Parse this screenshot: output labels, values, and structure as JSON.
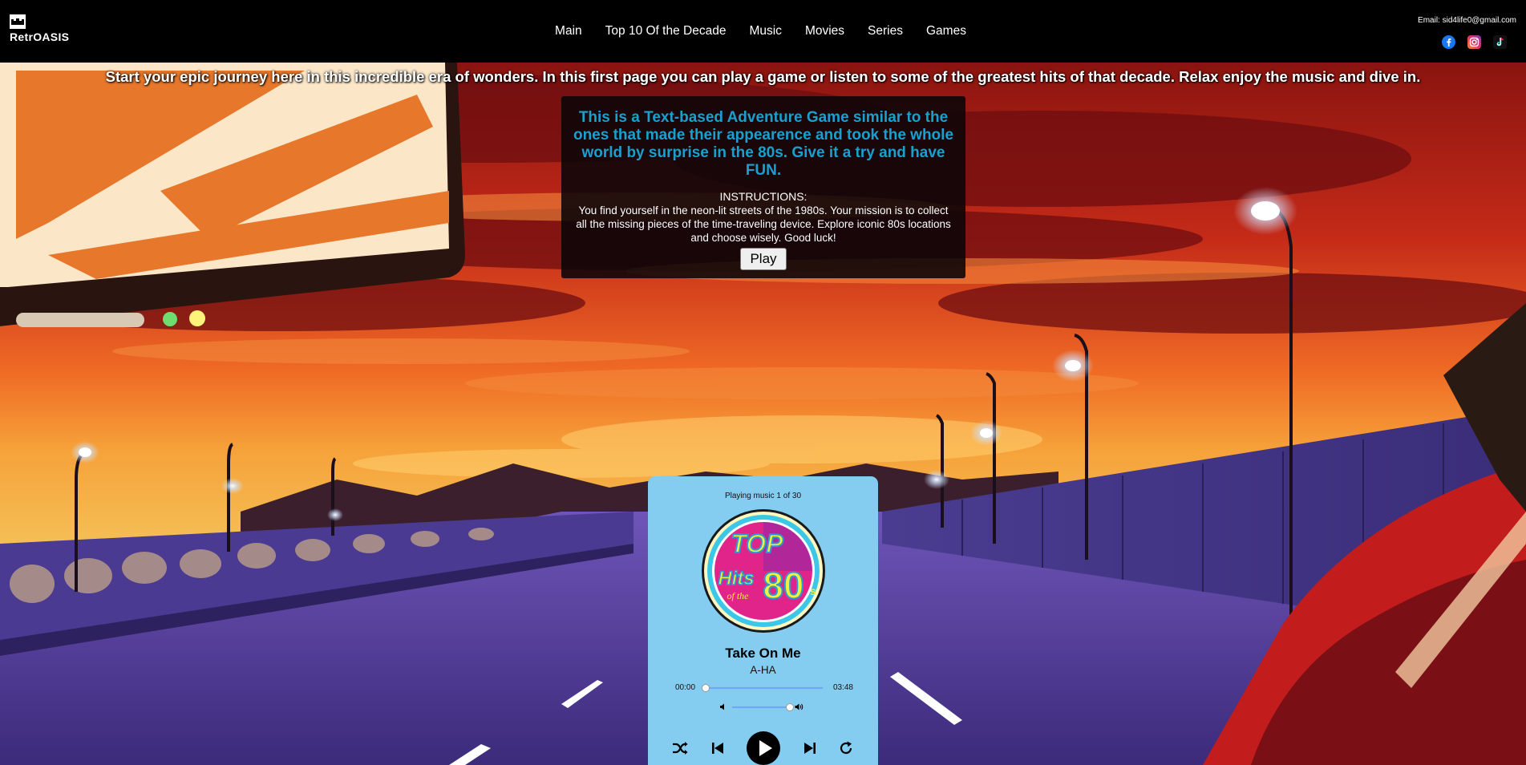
{
  "brand": {
    "name": "RetrOASIS",
    "logo_icon": "castle-logo-icon"
  },
  "nav": {
    "links": [
      {
        "label": "Main"
      },
      {
        "label": "Top 10 Of the Decade"
      },
      {
        "label": "Music"
      },
      {
        "label": "Movies"
      },
      {
        "label": "Series"
      },
      {
        "label": "Games"
      }
    ]
  },
  "contact": {
    "email": "Email: sid4life0@gmail.com",
    "socials": [
      "facebook-icon",
      "instagram-icon",
      "tiktok-icon"
    ]
  },
  "hero": {
    "text": "Start your epic journey here in this incredible era of wonders. In this first page you can play a game or listen to some of the greatest hits of that decade. Relax enjoy the music and dive in."
  },
  "game": {
    "title": "This is a Text-based Adventure Game similar to the ones that made their appearence and took the whole world by surprise in the 80s. Give it a try and have FUN.",
    "instructions_label": "INSTRUCTIONS:",
    "instructions_text": "You find yourself in the neon-lit streets of the 1980s. Your mission is to collect all the missing pieces of the time-traveling device. Explore iconic 80s locations and choose wisely. Good luck!",
    "play_label": "Play"
  },
  "player": {
    "status": "Playing music 1 of 30",
    "album_text": {
      "top": "TOP",
      "hits": "Hits",
      "of_the": "of the",
      "decade": "80",
      "s": "s"
    },
    "track_title": "Take On Me",
    "artist": "A-HA",
    "time_current": "00:00",
    "time_total": "03:48",
    "progress_fraction": 0,
    "volume_fraction": 1,
    "controls": [
      "shuffle-icon",
      "previous-icon",
      "play-icon",
      "next-icon",
      "repeat-icon"
    ]
  },
  "colors": {
    "player_bg": "#84cdf1",
    "game_title": "#1aa0cf",
    "slider": "#6fa4ff",
    "sky_top": "#9a1a12",
    "sky_mid": "#e2471c",
    "road": "#5a3f9e"
  }
}
